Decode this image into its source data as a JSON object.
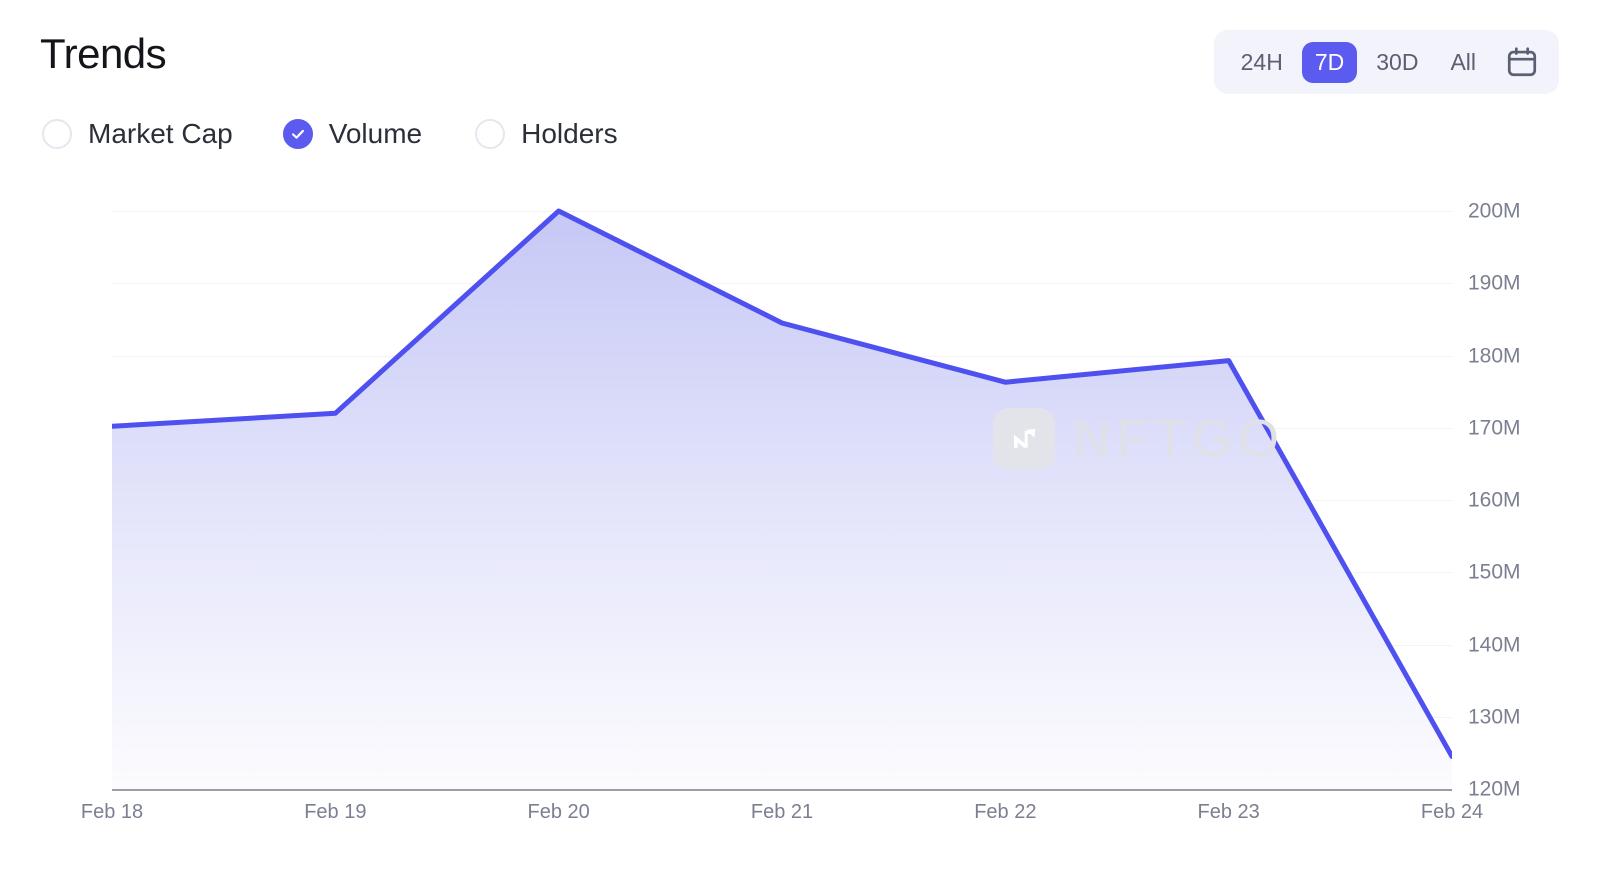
{
  "header": {
    "title": "Trends",
    "ranges": [
      {
        "label": "24H",
        "active": false
      },
      {
        "label": "7D",
        "active": true
      },
      {
        "label": "30D",
        "active": false
      },
      {
        "label": "All",
        "active": false
      }
    ],
    "calendar_icon": "calendar-icon"
  },
  "metrics": [
    {
      "label": "Market Cap",
      "checked": false
    },
    {
      "label": "Volume",
      "checked": true
    },
    {
      "label": "Holders",
      "checked": false
    }
  ],
  "watermark": {
    "text": "NFTGO",
    "logo_icon": "nftgo-logo-icon"
  },
  "colors": {
    "accent": "#5B5BF0",
    "line": "#4F50F0",
    "area_top": "#C9CBF7",
    "area_bottom": "#FBFBFE",
    "tick_text": "#7B7F90",
    "grid": "#F4F4F7",
    "axis": "#9A9CAB",
    "pill_bg": "#F2F3FB",
    "title": "#14151A"
  },
  "chart_data": {
    "type": "area",
    "title": "Trends",
    "series_name": "Volume",
    "xlabel": "",
    "ylabel": "",
    "categories": [
      "Feb 18",
      "Feb 19",
      "Feb 20",
      "Feb 21",
      "Feb 22",
      "Feb 23",
      "Feb 24"
    ],
    "values": [
      170.2,
      172.0,
      200.0,
      184.5,
      176.3,
      179.3,
      124.5
    ],
    "ylim": [
      120,
      200
    ],
    "ytick_labels": [
      "200M",
      "190M",
      "180M",
      "170M",
      "160M",
      "150M",
      "140M",
      "130M",
      "120M"
    ],
    "ytick_values": [
      200,
      190,
      180,
      170,
      160,
      150,
      140,
      130,
      120
    ],
    "unit": "M",
    "grid": true,
    "legend": false
  }
}
